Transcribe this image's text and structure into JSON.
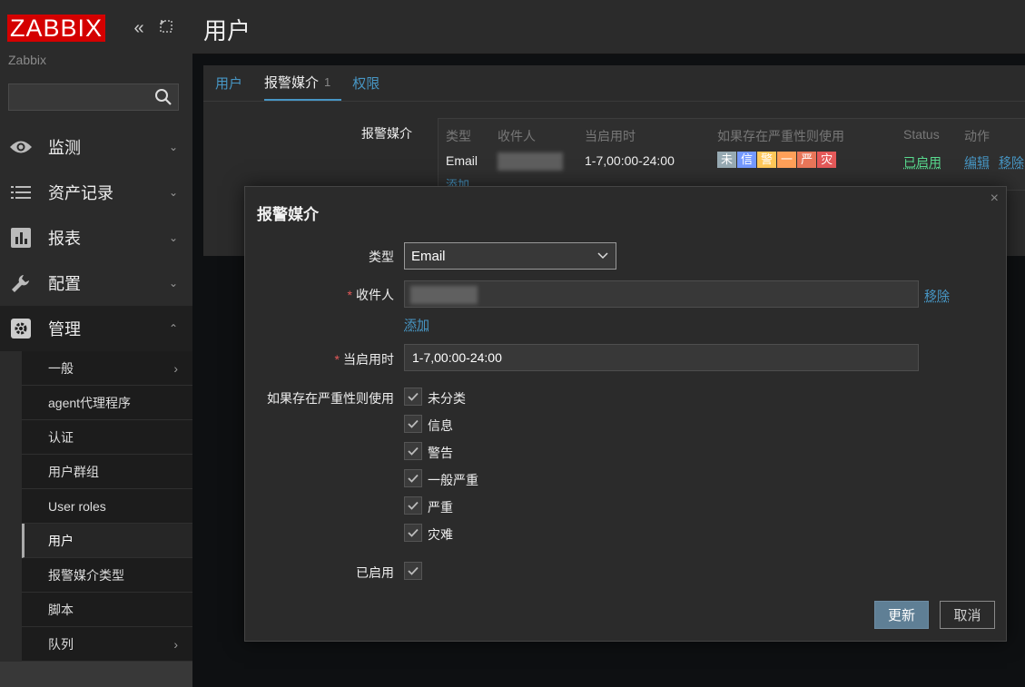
{
  "sidebar": {
    "logo": "ZABBIX",
    "server_name": "Zabbix",
    "search": {
      "value": "",
      "placeholder": ""
    },
    "menu": [
      {
        "label": "监测",
        "icon": "eye-icon"
      },
      {
        "label": "资产记录",
        "icon": "list-icon"
      },
      {
        "label": "报表",
        "icon": "bar-chart-icon"
      },
      {
        "label": "配置",
        "icon": "wrench-icon"
      },
      {
        "label": "管理",
        "icon": "gear-icon"
      }
    ],
    "admin_submenu": [
      {
        "label": "一般",
        "has_arrow": true
      },
      {
        "label": "agent代理程序"
      },
      {
        "label": "认证"
      },
      {
        "label": "用户群组"
      },
      {
        "label": "User roles"
      },
      {
        "label": "用户",
        "current": true
      },
      {
        "label": "报警媒介类型"
      },
      {
        "label": "脚本"
      },
      {
        "label": "队列",
        "has_arrow": true
      }
    ]
  },
  "page": {
    "title": "用户",
    "tabs": [
      {
        "label": "用户"
      },
      {
        "label": "报警媒介",
        "count": "1",
        "active": true
      },
      {
        "label": "权限"
      }
    ],
    "media_label": "报警媒介",
    "media_table": {
      "headers": [
        "类型",
        "收件人",
        "当启用时",
        "如果存在严重性则使用",
        "Status",
        "动作"
      ],
      "row": {
        "type": "Email",
        "when_active": "1-7,00:00-24:00",
        "severities": [
          {
            "label": "未",
            "color": "#97aab3"
          },
          {
            "label": "信",
            "color": "#7499ff"
          },
          {
            "label": "警",
            "color": "#ffc859"
          },
          {
            "label": "一",
            "color": "#ffa059"
          },
          {
            "label": "严",
            "color": "#e97659"
          },
          {
            "label": "灾",
            "color": "#e45959"
          }
        ],
        "status": "已启用",
        "edit": "编辑",
        "remove": "移除"
      },
      "add_link": "添加"
    }
  },
  "dialog": {
    "title": "报警媒介",
    "type_label": "类型",
    "type_value": "Email",
    "recipient_label": "收件人",
    "recipient_remove": "移除",
    "recipient_add": "添加",
    "when_active_label": "当启用时",
    "when_active_value": "1-7,00:00-24:00",
    "severity_label": "如果存在严重性则使用",
    "severities": [
      "未分类",
      "信息",
      "警告",
      "一般严重",
      "严重",
      "灾难"
    ],
    "enabled_label": "已启用",
    "update_button": "更新",
    "cancel_button": "取消"
  },
  "colors": {
    "accent_link": "#4796c4",
    "enabled_green": "#59db8f",
    "required_red": "#e45959",
    "primary_button": "#5f7f95",
    "logo_red": "#d40000"
  }
}
